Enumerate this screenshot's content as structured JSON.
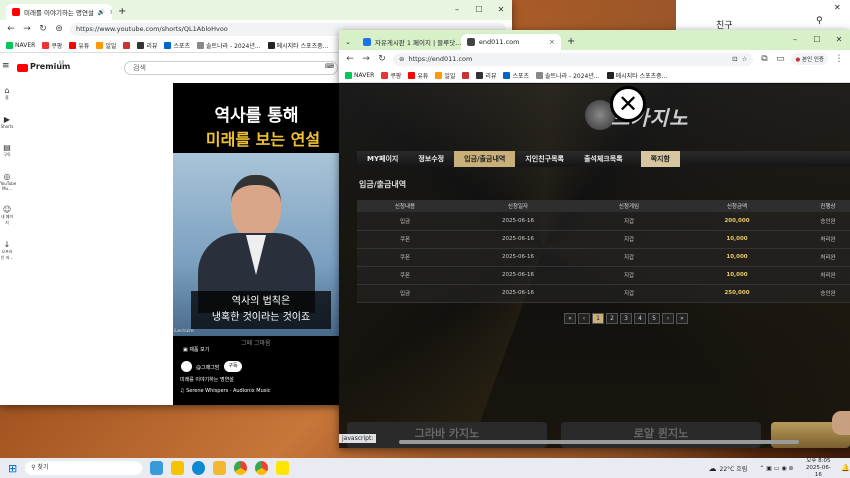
{
  "yt_window": {
    "tab_title": "미래를 이야기하는 명연설",
    "url": "https://www.youtube.com/shorts/QL1AbloHvoo",
    "bookmarks": [
      "NAVER",
      "쿠팡",
      "유튜",
      "일일",
      "",
      "리뷰",
      "스포츠",
      "솔트나라 - 2024년...",
      "메시지타 스포츠중..."
    ],
    "logo": "Premium",
    "logo_sup": "KR",
    "search_placeholder": "검색",
    "side": [
      {
        "icon": "⌂",
        "label": "홈"
      },
      {
        "icon": "▶",
        "label": "Shorts"
      },
      {
        "icon": "▤",
        "label": "구독"
      },
      {
        "icon": "◎",
        "label": "YouTube Mu..."
      },
      {
        "icon": "☺",
        "label": "내 페이지"
      },
      {
        "icon": "↓",
        "label": "오프라인 저..."
      }
    ],
    "video_title_1": "역사를 통해",
    "video_title_2": "미래를 보는 연설",
    "subtitle_1": "역사의 법칙은",
    "subtitle_2": "냉혹한 것이라는 것이죠",
    "lecture_tag": "Lecture",
    "watermark": "그때 그마음",
    "action_label": "제품 보기",
    "channel": "@그때그맘",
    "subscribe": "구독",
    "desc": "미래를 이야기하는 명연설",
    "music": "♫ Serene Whispers · Audionix Music"
  },
  "casino_window": {
    "tab_title": "자유게시판 1 페이지 | 블루닷...",
    "url_short": "end011.com",
    "url": "https://end011.com",
    "bookmarks": [
      "NAVER",
      "쿠팡",
      "유튜",
      "일일",
      "",
      "리뷰",
      "스포츠",
      "솔트나라 - 2024년...",
      "메시지타 스포츠중..."
    ],
    "profile": "본인 인증",
    "logo_text": "드카지노",
    "close_icon_label": "✕",
    "menu": [
      "MY페이지",
      "정보수정",
      "입금/출금내역",
      "지인친구목록",
      "출석체크목록",
      "쪽지함"
    ],
    "section_title": "입금/출금내역",
    "table": {
      "headers": [
        "신청내용",
        "신청일자",
        "신청게임",
        "신청금액",
        "진행상"
      ],
      "rows": [
        [
          "입금",
          "2025-06-16",
          "지갑",
          "200,000",
          "승인완"
        ],
        [
          "쿠폰",
          "2025-06-16",
          "지갑",
          "10,000",
          "처리완"
        ],
        [
          "쿠폰",
          "2025-06-16",
          "지갑",
          "10,000",
          "처리완"
        ],
        [
          "쿠폰",
          "2025-06-16",
          "지갑",
          "10,000",
          "처리완"
        ],
        [
          "입금",
          "2025-06-16",
          "지갑",
          "250,000",
          "승인완"
        ]
      ]
    },
    "pager": [
      "«",
      "‹",
      "1",
      "2",
      "3",
      "4",
      "5",
      "›",
      "»"
    ],
    "status_url": "javascript:",
    "footer_btn_1": "그라바 카지노",
    "footer_btn_2": "로얄 퀸지노"
  },
  "friends_panel": {
    "title": "친구"
  },
  "taskbar": {
    "search": "찾기",
    "weather": "22°C 흐림",
    "time": "오후 8:05",
    "date": "2025-06-16"
  }
}
